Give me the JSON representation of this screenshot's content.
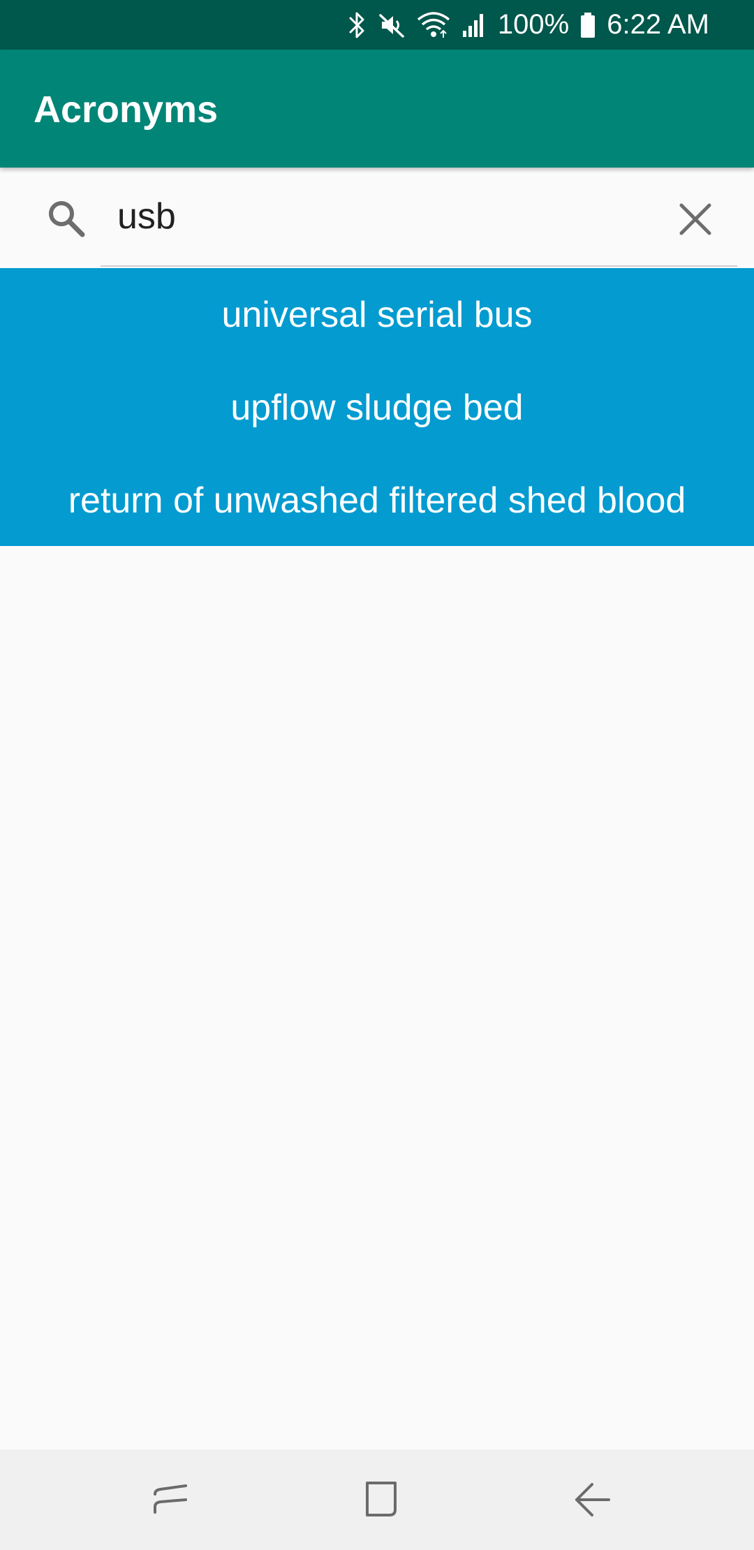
{
  "status_bar": {
    "battery_text": "100%",
    "time": "6:22 AM",
    "icons": [
      "bluetooth-icon",
      "mute-icon",
      "wifi-icon",
      "signal-icon",
      "battery-icon"
    ]
  },
  "app_bar": {
    "title": "Acronyms",
    "color": "#008577"
  },
  "search": {
    "value": "usb",
    "icon": "search-icon",
    "clear_icon": "close-icon"
  },
  "results": {
    "background": "#039bd0",
    "items": [
      {
        "label": "universal serial bus"
      },
      {
        "label": "upflow sludge bed"
      },
      {
        "label": "return of unwashed filtered shed blood"
      }
    ]
  },
  "nav_bar": {
    "buttons": [
      "recent-apps-icon",
      "home-icon",
      "back-icon"
    ]
  }
}
